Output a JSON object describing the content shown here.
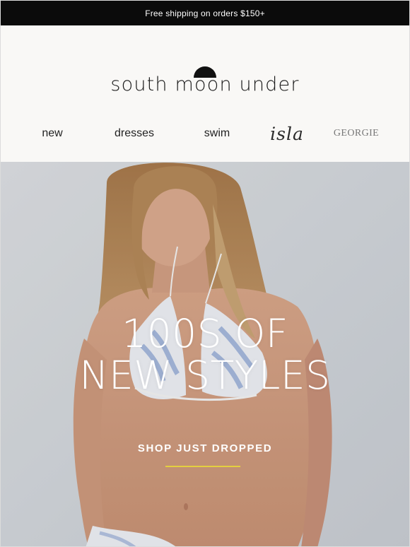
{
  "promo": {
    "text": "Free shipping on orders $150+"
  },
  "brand": {
    "logo_text": "south moon under"
  },
  "nav": {
    "new": "new",
    "dresses": "dresses",
    "swim": "swim",
    "isla": "isla",
    "georgie": "GEORGIE"
  },
  "hero": {
    "title_line1": "100S OF",
    "title_line2": "NEW STYLES",
    "cta": "SHOP JUST DROPPED",
    "underline_color": "#e4cf3f"
  },
  "colors": {
    "promo_bg": "#0b0b0b",
    "header_bg": "#f9f8f6",
    "hero_bg": "#d5d9de"
  },
  "icons": {
    "logo_mark": "half-moon-icon"
  }
}
